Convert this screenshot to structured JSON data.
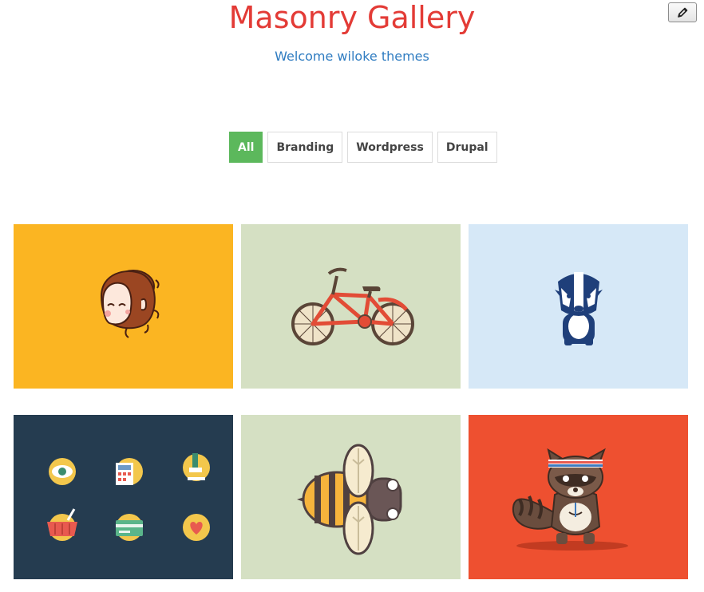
{
  "header": {
    "title": "Masonry Gallery",
    "subtitle": "Welcome wiloke themes"
  },
  "edit_button": {
    "icon": "pencil-icon"
  },
  "filters": [
    {
      "label": "All",
      "active": true
    },
    {
      "label": "Branding",
      "active": false
    },
    {
      "label": "Wordpress",
      "active": false
    },
    {
      "label": "Drupal",
      "active": false
    }
  ],
  "colors": {
    "title": "#e33b36",
    "subtitle": "#2f7cc1",
    "active_filter": "#5cb85c"
  },
  "gallery": [
    {
      "name": "girl-illustration",
      "background": "#fbb522"
    },
    {
      "name": "bicycle-illustration",
      "background": "#d5e0c3"
    },
    {
      "name": "badger-illustration",
      "background": "#d6e8f7"
    },
    {
      "name": "icon-set-illustration",
      "background": "#253c50"
    },
    {
      "name": "bee-illustration",
      "background": "#d5e0c3"
    },
    {
      "name": "raccoon-illustration",
      "background": "#ee5030"
    }
  ]
}
